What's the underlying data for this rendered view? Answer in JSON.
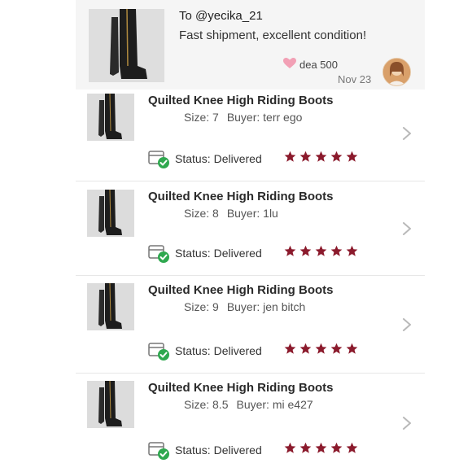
{
  "review": {
    "to_label": "To @yecika_21",
    "message": "Fast shipment, excellent condition!",
    "from_user": "dea      500",
    "date": "Nov 23"
  },
  "orders": [
    {
      "title": "Quilted Knee High Riding Boots",
      "size": "Size: 7",
      "buyer": "Buyer: terr       ego",
      "status_label": "Status:",
      "status_value": "Delivered",
      "rating": 5
    },
    {
      "title": "Quilted Knee High Riding Boots",
      "size": "Size: 8",
      "buyer": "Buyer: 1lu",
      "status_label": "Status:",
      "status_value": "Delivered",
      "rating": 5
    },
    {
      "title": "Quilted Knee High Riding Boots",
      "size": "Size: 9",
      "buyer": "Buyer: jen       bitch",
      "status_label": "Status:",
      "status_value": "Delivered",
      "rating": 5
    },
    {
      "title": "Quilted Knee High Riding Boots",
      "size": "Size: 8.5",
      "buyer": "Buyer: mi        e427",
      "status_label": "Status:",
      "status_value": "Delivered",
      "rating": 5
    }
  ],
  "colors": {
    "star": "#8b1a2c",
    "check": "#2fa84f",
    "heart": "#f2a0b5"
  },
  "icons": {
    "chevron": "chevron-right-icon",
    "status": "package-delivered-icon",
    "star": "star-icon"
  }
}
